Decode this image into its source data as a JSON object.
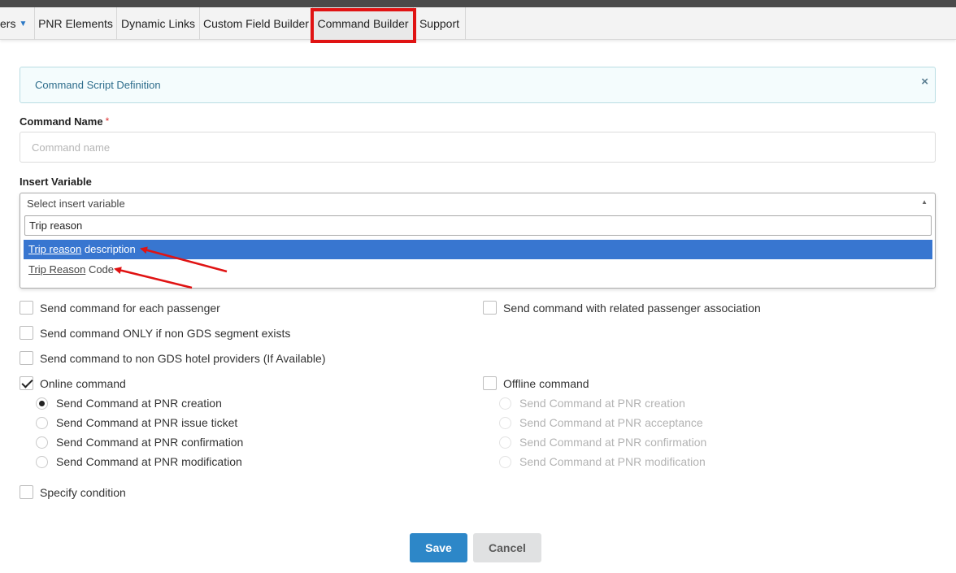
{
  "nav": {
    "items": [
      {
        "label": "ers",
        "dropdown": true
      },
      {
        "label": "PNR Elements"
      },
      {
        "label": "Dynamic Links"
      },
      {
        "label": "Custom Field Builder"
      },
      {
        "label": "Command Builder",
        "active": true
      },
      {
        "label": "Support"
      }
    ]
  },
  "panel": {
    "title": "Command Script Definition",
    "close_icon": "×"
  },
  "command_name": {
    "label": "Command Name",
    "required_mark": "*",
    "placeholder": "Command name",
    "value": ""
  },
  "insert_variable": {
    "label": "Insert Variable",
    "placeholder": "Select insert variable",
    "search_value": "Trip reason",
    "options": [
      {
        "match": "Trip reason",
        "rest": " description",
        "highlighted": true
      },
      {
        "match": "Trip Reason",
        "rest": " Code",
        "highlighted": false
      }
    ]
  },
  "checkboxes": {
    "each_passenger": {
      "label": "Send command for each passenger",
      "checked": false
    },
    "related_association": {
      "label": "Send command with related passenger association",
      "checked": false
    },
    "non_gds_segment": {
      "label": "Send command ONLY if non GDS segment exists",
      "checked": false
    },
    "non_gds_hotel": {
      "label": "Send command to non GDS hotel providers (If Available)",
      "checked": false
    },
    "online": {
      "label": "Online command",
      "checked": true
    },
    "offline": {
      "label": "Offline command",
      "checked": false
    },
    "specify_condition": {
      "label": "Specify condition",
      "checked": false
    }
  },
  "online_radios": [
    {
      "label": "Send Command at PNR creation",
      "selected": true
    },
    {
      "label": "Send Command at PNR issue ticket",
      "selected": false
    },
    {
      "label": "Send Command at PNR confirmation",
      "selected": false
    },
    {
      "label": "Send Command at PNR modification",
      "selected": false
    }
  ],
  "offline_radios": [
    {
      "label": "Send Command at PNR creation",
      "disabled": true
    },
    {
      "label": "Send Command at PNR acceptance",
      "disabled": true
    },
    {
      "label": "Send Command at PNR confirmation",
      "disabled": true
    },
    {
      "label": "Send Command at PNR modification",
      "disabled": true
    }
  ],
  "buttons": {
    "save": "Save",
    "cancel": "Cancel"
  },
  "colors": {
    "accent": "#2d87c8",
    "highlight_option": "#3876d0",
    "annotation_red": "#e01313"
  }
}
